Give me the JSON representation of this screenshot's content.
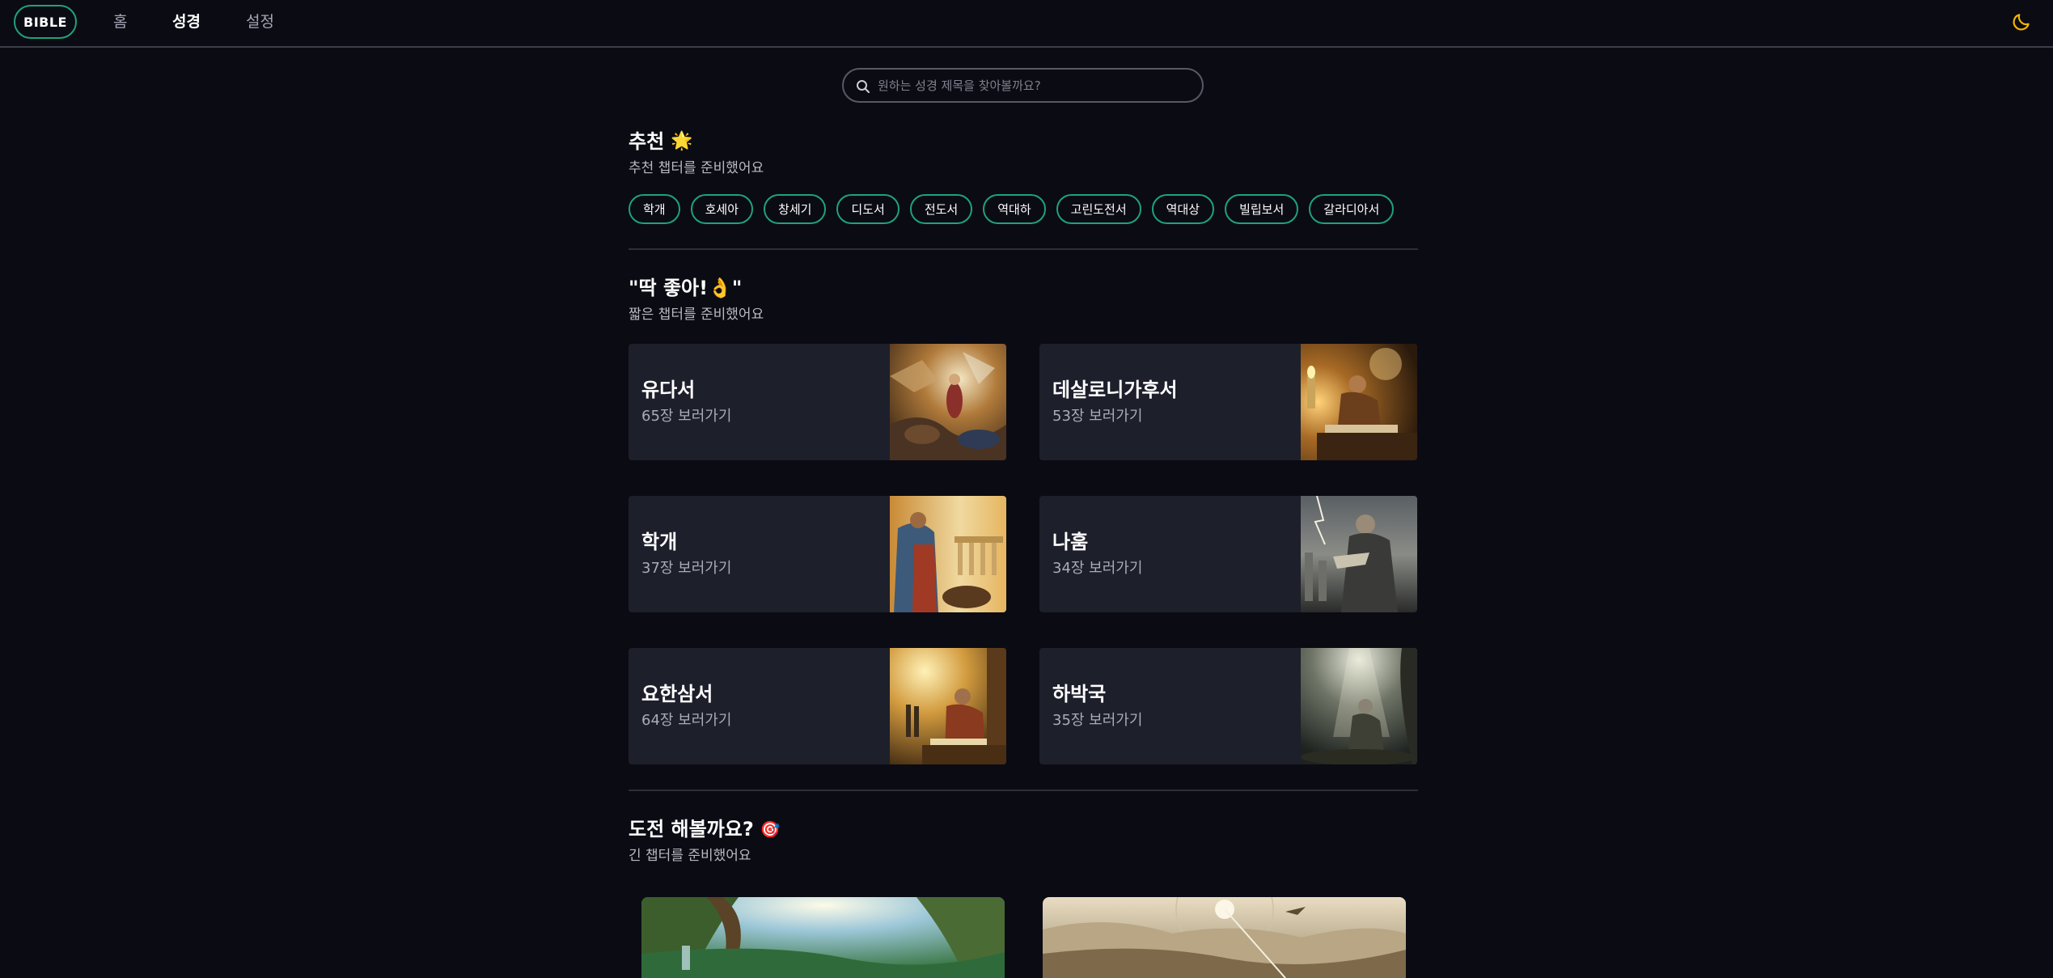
{
  "nav": {
    "logo": "BIBLE",
    "links": [
      "홈",
      "성경",
      "설정"
    ],
    "active_index": 1,
    "theme_icon": "moon-icon",
    "accent_color": "#1fa27b",
    "theme_icon_color": "#f4b400"
  },
  "search": {
    "placeholder": "원하는 성경 제목을 찾아볼까요?",
    "icon": "search-icon"
  },
  "recommend": {
    "title": "추천",
    "emoji": "🌟",
    "subtitle": "추천 챕터를 준비했어요",
    "chips": [
      "학개",
      "호세아",
      "창세기",
      "디도서",
      "전도서",
      "역대하",
      "고린도전서",
      "역대상",
      "빌립보서",
      "갈라디아서"
    ]
  },
  "short": {
    "title": "\"딱 좋아!👌\"",
    "subtitle": "짧은 챕터를 준비했어요",
    "cards": [
      {
        "title": "유다서",
        "subtitle": "65장 보러가기"
      },
      {
        "title": "데살로니가후서",
        "subtitle": "53장 보러가기"
      },
      {
        "title": "학개",
        "subtitle": "37장 보러가기"
      },
      {
        "title": "나훔",
        "subtitle": "34장 보러가기"
      },
      {
        "title": "요한삼서",
        "subtitle": "64장 보러가기"
      },
      {
        "title": "하박국",
        "subtitle": "35장 보러가기"
      }
    ]
  },
  "challenge": {
    "title": "도전 해볼까요?",
    "emoji": "🎯",
    "subtitle": "긴 챕터를 준비했어요"
  }
}
